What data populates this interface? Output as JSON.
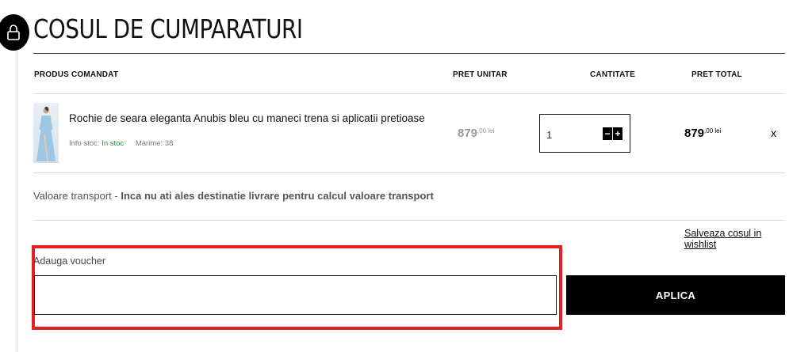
{
  "header": {
    "title": "COSUL DE CUMPARATURI"
  },
  "table": {
    "columns": [
      "PRODUS COMANDAT",
      "PRET UNITAR",
      "CANTITATE",
      "PRET TOTAL"
    ]
  },
  "item": {
    "name": "Rochie de seara eleganta Anubis bleu cu maneci trena si aplicatii pretioase",
    "stock_label": "Info stoc:",
    "stock_value": "In stoc",
    "size": "Marime: 38",
    "unit_price_main": "879",
    "unit_price_sup": ",00 lei",
    "quantity": "1",
    "minus": "−",
    "plus": "+",
    "total_main": "879",
    "total_sup": ",00 lei",
    "remove": "x"
  },
  "transport": {
    "label": "Valoare transport -",
    "value": "Inca nu ati ales destinatie livrare pentru calcul valoare transport"
  },
  "wishlist_link": "Salveaza cosul in wishlist",
  "voucher": {
    "label": "Adauga voucher",
    "value": "",
    "button": "APLICA"
  },
  "colors": {
    "accent_black": "#000000",
    "stock_green": "#2e8b3e",
    "highlight_red": "#e31e24"
  }
}
